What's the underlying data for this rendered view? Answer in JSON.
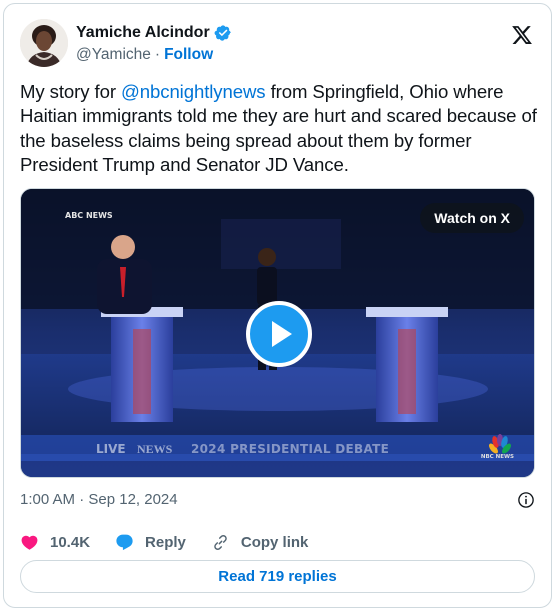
{
  "author": {
    "display_name": "Yamiche Alcindor",
    "handle": "@Yamiche",
    "separator": "·",
    "follow_label": "Follow"
  },
  "tweet": {
    "text_before_mention": "My story for ",
    "mention": "@nbcnightlynews",
    "text_after_mention": " from Springfield, Ohio where Haitian immigrants told me they are hurt and scared because of the baseless claims being spread about them by former President Trump and Senator JD Vance."
  },
  "media": {
    "watch_label": "Watch on X",
    "network_tag": "ABC NEWS",
    "chyron_live": "LIVE",
    "chyron_news": "NEWS",
    "chyron_debate": "2024 PRESIDENTIAL DEBATE",
    "nbc_label": "NBC NEWS"
  },
  "timestamp": "1:00 AM · Sep 12, 2024",
  "actions": {
    "likes_count": "10.4K",
    "reply_label": "Reply",
    "copy_link_label": "Copy link"
  },
  "read_replies_label": "Read 719 replies",
  "colors": {
    "link_blue": "#0074d6",
    "heart_red": "#f91880",
    "reply_blue": "#1d9bf0",
    "border": "#cfd9de",
    "muted": "#536471"
  },
  "icons": [
    "verified-badge-icon",
    "x-logo-icon",
    "play-icon",
    "info-icon",
    "heart-icon",
    "reply-bubble-icon",
    "link-icon"
  ]
}
